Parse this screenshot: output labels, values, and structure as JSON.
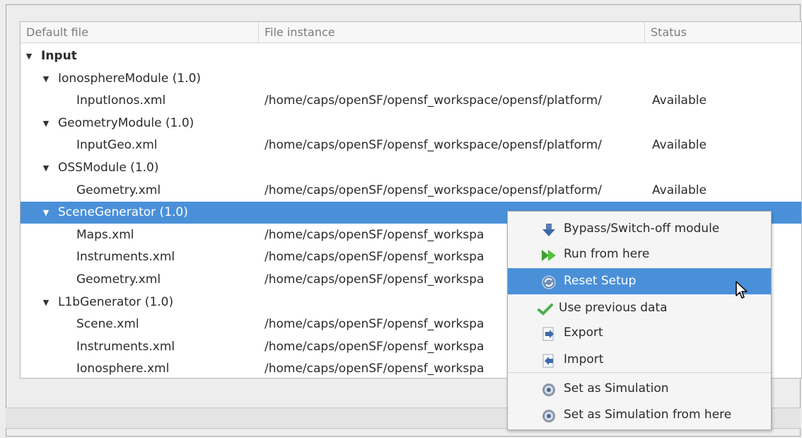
{
  "columns": {
    "default_file": "Default file",
    "file_instance": "File instance",
    "status": "Status"
  },
  "tree": {
    "root": "Input",
    "modules": [
      {
        "name": "IonosphereModule (1.0)",
        "files": [
          {
            "file": "InputIonos.xml",
            "instance": "/home/caps/openSF/opensf_workspace/opensf/platform/",
            "status": "Available"
          }
        ]
      },
      {
        "name": "GeometryModule (1.0)",
        "files": [
          {
            "file": "InputGeo.xml",
            "instance": "/home/caps/openSF/opensf_workspace/opensf/platform/",
            "status": "Available"
          }
        ]
      },
      {
        "name": "OSSModule (1.0)",
        "files": [
          {
            "file": "Geometry.xml",
            "instance": "/home/caps/openSF/opensf_workspace/opensf/platform/",
            "status": "Available"
          }
        ]
      },
      {
        "name": "SceneGenerator (1.0)",
        "selected": true,
        "files": [
          {
            "file": "Maps.xml",
            "instance": "/home/caps/openSF/opensf_workspa",
            "status": ""
          },
          {
            "file": "Instruments.xml",
            "instance": "/home/caps/openSF/opensf_workspa",
            "status": ""
          },
          {
            "file": "Geometry.xml",
            "instance": "/home/caps/openSF/opensf_workspa",
            "status": ""
          }
        ]
      },
      {
        "name": "L1bGenerator (1.0)",
        "files": [
          {
            "file": "Scene.xml",
            "instance": "/home/caps/openSF/opensf_workspa",
            "status": ""
          },
          {
            "file": "Instruments.xml",
            "instance": "/home/caps/openSF/opensf_workspa",
            "status": ""
          },
          {
            "file": "Ionosphere.xml",
            "instance": "/home/caps/openSF/opensf_workspa",
            "status": ""
          }
        ]
      }
    ]
  },
  "context_menu": {
    "items": [
      {
        "label": "Bypass/Switch-off module",
        "icon": "bypass-arrow-icon"
      },
      {
        "label": "Run from here",
        "icon": "fast-forward-icon"
      },
      {
        "label": "Reset Setup",
        "icon": "reset-icon",
        "active": true
      },
      {
        "label": "Use previous data",
        "icon": "checkmark-icon"
      },
      {
        "label": "Export",
        "icon": "export-icon"
      },
      {
        "label": "Import",
        "icon": "import-icon"
      },
      {
        "label": "Set as Simulation",
        "icon": "gear-icon"
      },
      {
        "label": "Set as Simulation from here",
        "icon": "gear-icon"
      }
    ]
  },
  "colors": {
    "selection": "#4a90d9",
    "available_text": "#2b2b2b"
  }
}
